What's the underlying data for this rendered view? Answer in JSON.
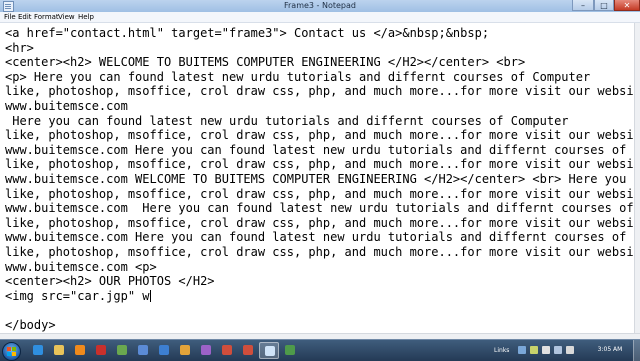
{
  "window": {
    "title": "Frame3 - Notepad",
    "minimize_glyph": "–",
    "maximize_glyph": "□",
    "close_glyph": "✕"
  },
  "menu": {
    "items": [
      "File",
      "Edit",
      "Format",
      "View",
      "Help"
    ]
  },
  "editor": {
    "lines": [
      "<a href=\"contact.html\" target=\"frame3\"> Contact us </a>&nbsp;&nbsp;",
      "<hr>",
      "<center><h2> WELCOME TO BUITEMS COMPUTER ENGINEERING </H2></center> <br>",
      "<p> Here you can found latest new urdu tutorials and differnt courses of Computer",
      "like, photoshop, msoffice, crol draw css, php, and much more...for more visit our website",
      "www.buitemsce.com",
      " Here you can found latest new urdu tutorials and differnt courses of Computer",
      "like, photoshop, msoffice, crol draw css, php, and much more...for more visit our website",
      "www.buitemsce.com Here you can found latest new urdu tutorials and differnt courses of Co",
      "like, photoshop, msoffice, crol draw css, php, and much more...for more visit our website",
      "www.buitemsce.com WELCOME TO BUITEMS COMPUTER ENGINEERING </H2></center> <br> Here you can",
      "like, photoshop, msoffice, crol draw css, php, and much more...for more visit our website",
      "www.buitemsce.com  Here you can found latest new urdu tutorials and differnt courses of Co",
      "like, photoshop, msoffice, crol draw css, php, and much more...for more visit our website",
      "www.buitemsce.com Here you can found latest new urdu tutorials and differnt courses of Co",
      "like, photoshop, msoffice, crol draw css, php, and much more...for more visit our website",
      "www.buitemsce.com <p>",
      "<center><h2> OUR PHOTOS </H2>",
      "<img src=\"car.jgp\" w",
      "",
      "</body>"
    ]
  },
  "taskbar": {
    "icons": [
      {
        "name": "ie-icon",
        "color": "#2f8fe0"
      },
      {
        "name": "folder-icon",
        "color": "#e8c35a"
      },
      {
        "name": "media-player-icon",
        "color": "#f08a1c"
      },
      {
        "name": "app-icon",
        "color": "#c9302c"
      },
      {
        "name": "game-icon",
        "color": "#6aa84f"
      },
      {
        "name": "app-icon",
        "color": "#5b8bd6"
      },
      {
        "name": "app-icon",
        "color": "#3d7fd1"
      },
      {
        "name": "app-icon",
        "color": "#e2a33a"
      },
      {
        "name": "app-icon",
        "color": "#9c62c8"
      },
      {
        "name": "app-icon",
        "color": "#d04e3c"
      },
      {
        "name": "app-icon",
        "color": "#d04e3c"
      },
      {
        "name": "notepad-icon",
        "color": "#cfe3f7"
      },
      {
        "name": "app-icon",
        "color": "#4e9a4a"
      }
    ],
    "tray_links": "Links",
    "clock": "3:05 AM"
  }
}
